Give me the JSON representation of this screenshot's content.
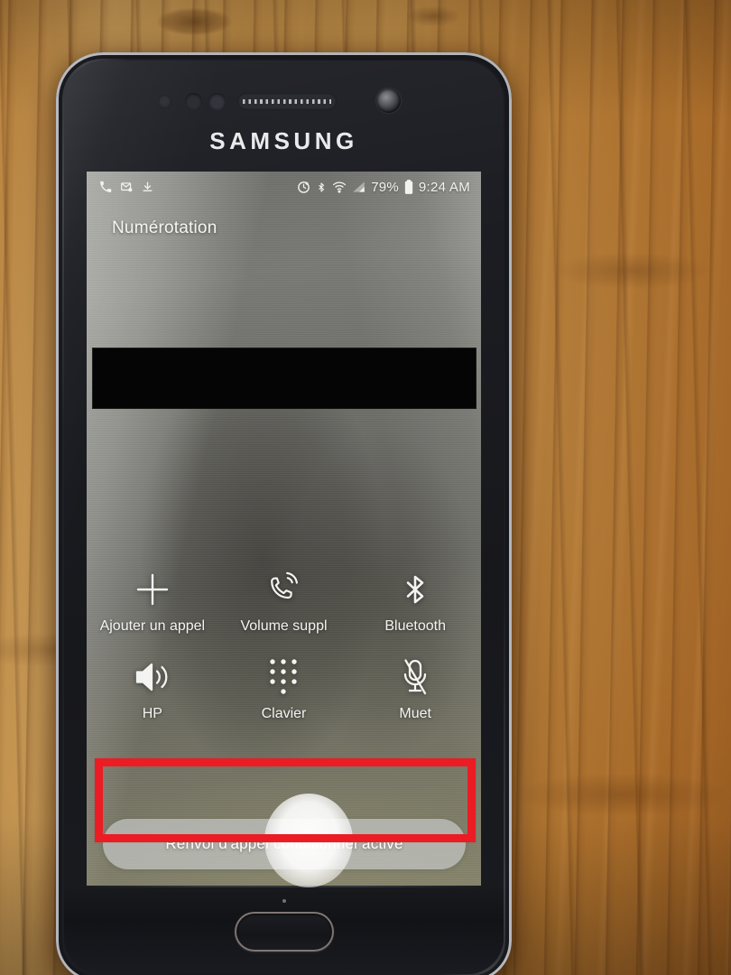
{
  "scene": {
    "surface": "wood-desk",
    "device_brand": "SAMSUNG"
  },
  "statusbar": {
    "left_icons": [
      {
        "name": "missed-call-icon",
        "label": "call"
      },
      {
        "name": "mms-settings-icon",
        "label": "message"
      },
      {
        "name": "download-icon",
        "label": "download"
      }
    ],
    "right_icons": [
      {
        "name": "alarm-add-icon",
        "label": "alarm"
      },
      {
        "name": "bluetooth-icon",
        "label": "Bluetooth"
      },
      {
        "name": "wifi-icon",
        "label": "Wi-Fi"
      },
      {
        "name": "signal-icon",
        "label": "signal"
      }
    ],
    "battery_percent": "79%",
    "battery_icon": "battery-icon",
    "clock": "9:24 AM"
  },
  "screen": {
    "title": "Numérotation",
    "redacted_field": "",
    "actions": [
      {
        "label": "Ajouter un appel",
        "icon": "plus-icon"
      },
      {
        "label": "Volume suppl",
        "icon": "phone-volume-icon"
      },
      {
        "label": "Bluetooth",
        "icon": "bluetooth-icon"
      },
      {
        "label": "HP",
        "icon": "speaker-icon"
      },
      {
        "label": "Clavier",
        "icon": "dialpad-icon"
      },
      {
        "label": "Muet",
        "icon": "mic-off-icon"
      }
    ],
    "toast": "Renvoi d'appel conditionnel activé"
  },
  "annotation": {
    "shape": "rectangle",
    "color": "#ec1c24",
    "target": "toast"
  },
  "colors": {
    "annotation_red": "#ec1c24",
    "wood": "#bd8a44",
    "screen_gray": "#6e6e69",
    "toast_fill": "#ced2d4",
    "text_white": "#ffffff",
    "redaction_black": "#050505"
  }
}
